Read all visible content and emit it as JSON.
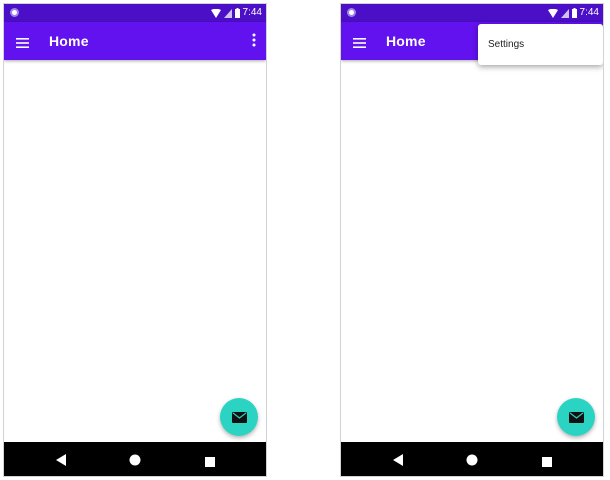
{
  "colors": {
    "status_bar": "#4b0fc7",
    "app_bar": "#6212ee",
    "fab": "#2bd4c2",
    "nav_bar": "#000000"
  },
  "screens": [
    {
      "status": {
        "time": "7:44"
      },
      "app_bar": {
        "title": "Home",
        "menu_icon": "hamburger-menu-icon",
        "overflow_icon": "more-vert-icon"
      },
      "fab": {
        "icon": "email-icon"
      },
      "nav": {
        "back_icon": "back-triangle-icon",
        "home_icon": "home-circle-icon",
        "recent_icon": "recent-square-icon"
      }
    },
    {
      "status": {
        "time": "7:44"
      },
      "app_bar": {
        "title": "Home",
        "menu_icon": "hamburger-menu-icon"
      },
      "overflow_menu": {
        "items": [
          {
            "label": "Settings"
          }
        ]
      },
      "fab": {
        "icon": "email-icon"
      },
      "nav": {
        "back_icon": "back-triangle-icon",
        "home_icon": "home-circle-icon",
        "recent_icon": "recent-square-icon"
      }
    }
  ]
}
